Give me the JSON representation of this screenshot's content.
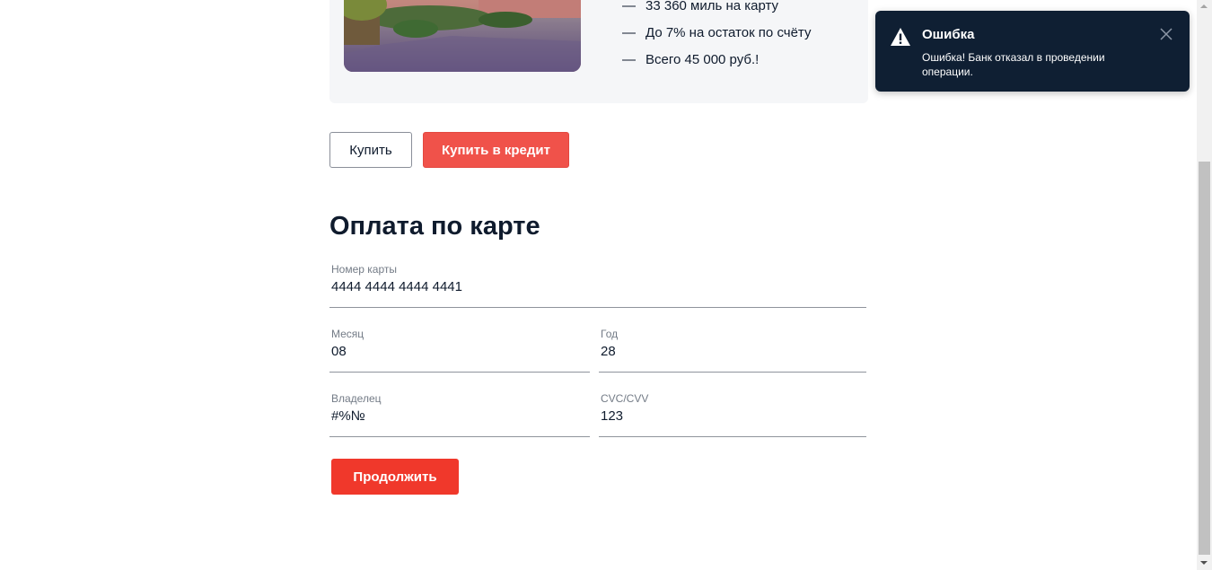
{
  "offer": {
    "photo_icon": "landscape-photo",
    "features": [
      "33 360 миль на карту",
      "До 7% на остаток по счёту",
      "Всего 45 000 руб.!"
    ],
    "feature_bullet": "—"
  },
  "actions": {
    "buy_label": "Купить",
    "credit_label": "Купить в кредит"
  },
  "form": {
    "title": "Оплата по карте",
    "card_number": {
      "label": "Номер карты",
      "value": "4444 4444 4444 4441"
    },
    "month": {
      "label": "Месяц",
      "value": "08"
    },
    "year": {
      "label": "Год",
      "value": "28"
    },
    "owner": {
      "label": "Владелец",
      "value": "#%№"
    },
    "cvc": {
      "label": "CVC/CVV",
      "value": "123"
    },
    "submit_label": "Продолжить"
  },
  "notification": {
    "icon": "warning-icon",
    "title": "Ошибка",
    "message": "Ошибка! Банк отказал в проведении операции.",
    "close_icon": "close-icon"
  },
  "colors": {
    "accent": "#f0524a",
    "submit": "#f0382b",
    "notification_bg": "#0f1f33",
    "text": "#0f1b2d"
  }
}
